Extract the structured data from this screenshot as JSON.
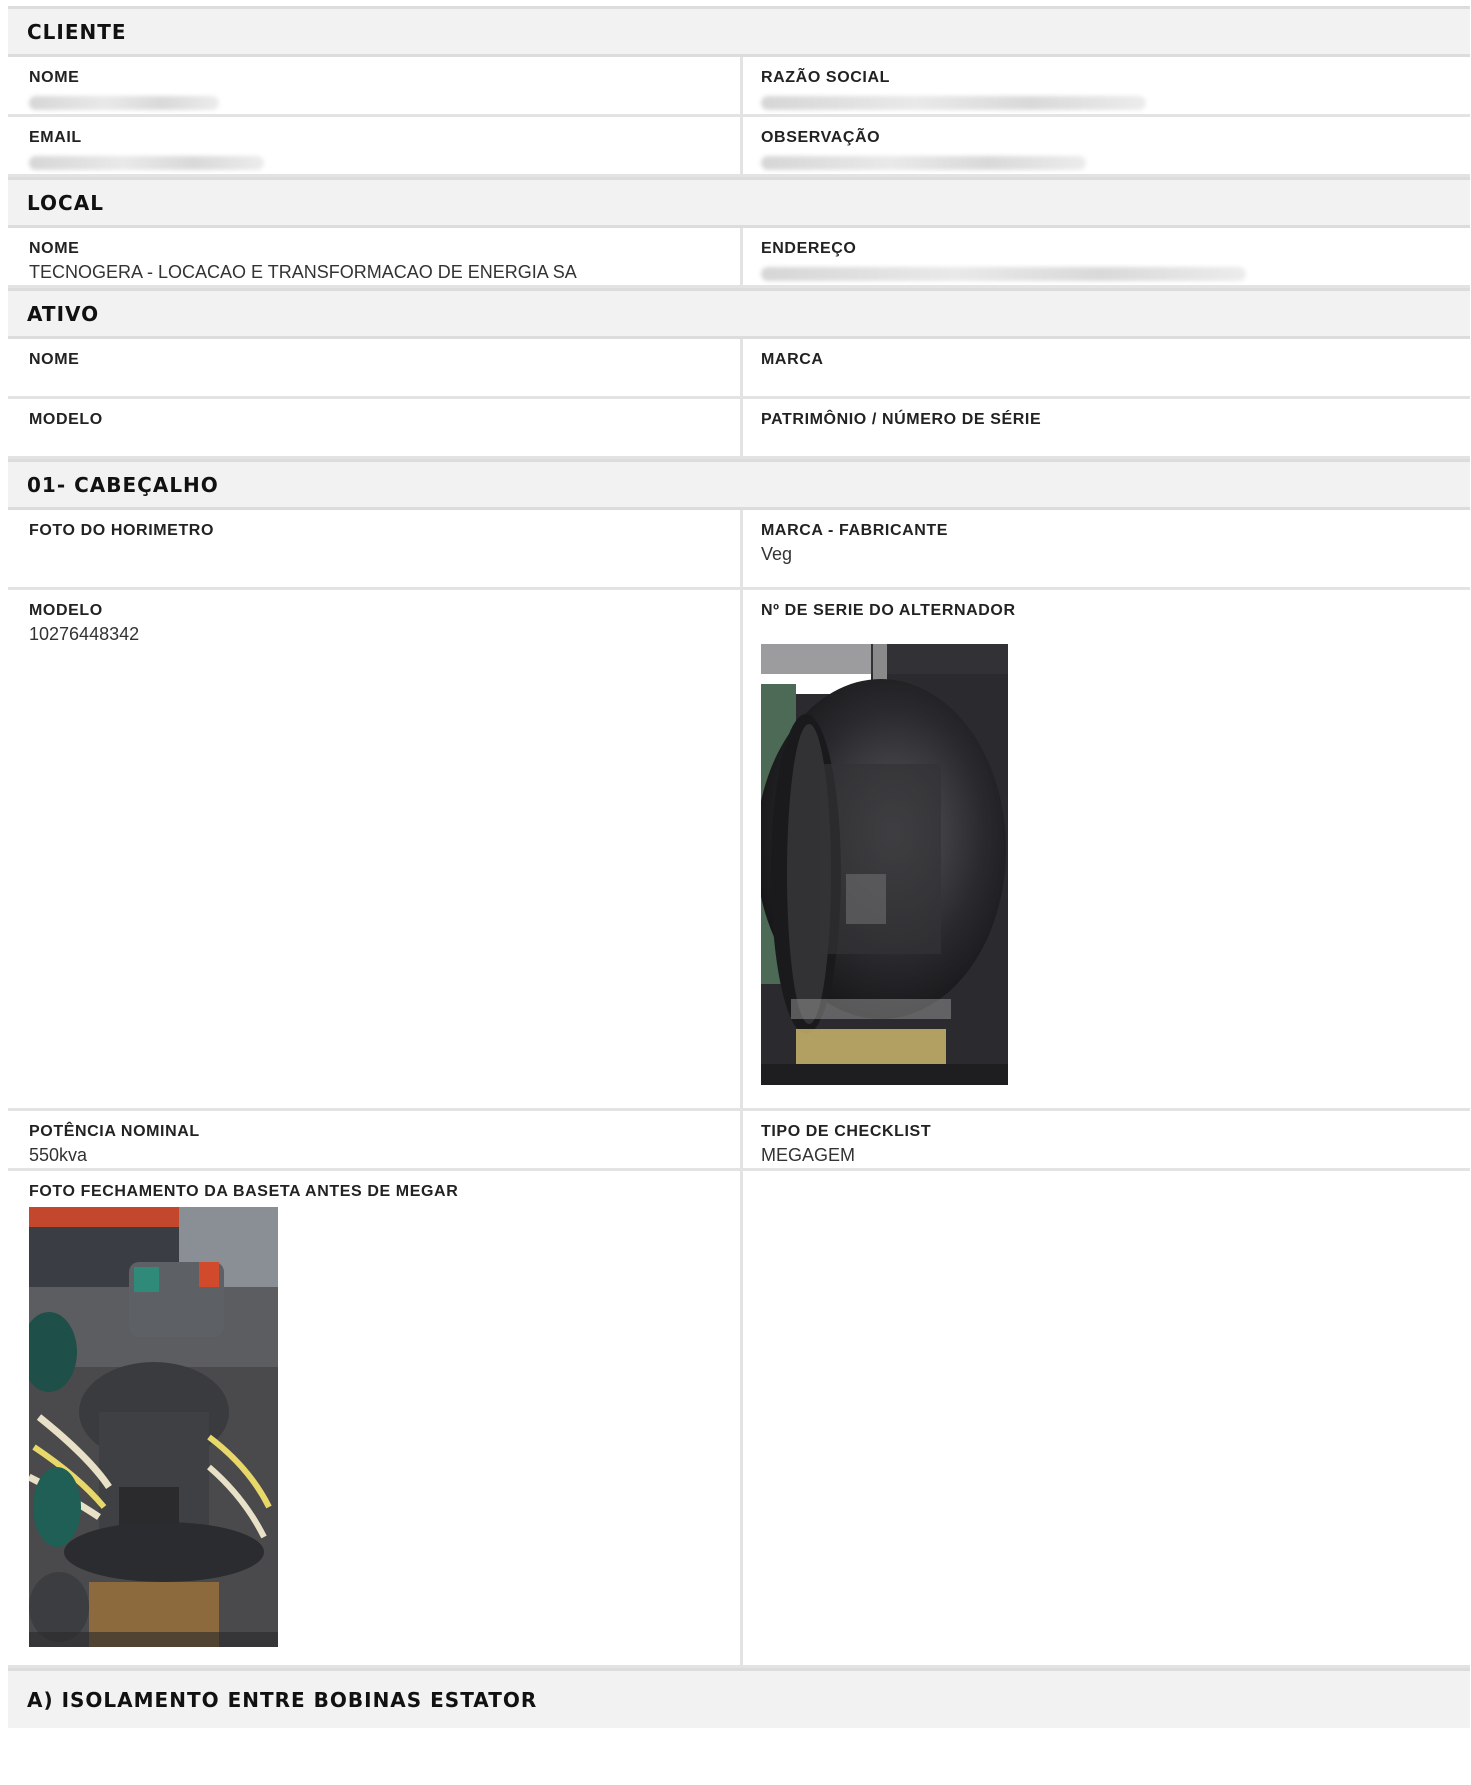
{
  "sections": {
    "cliente": {
      "title": "CLIENTE",
      "nome_label": "NOME",
      "razao_label": "RAZÃO SOCIAL",
      "email_label": "EMAIL",
      "obs_label": "OBSERVAÇÃO"
    },
    "local": {
      "title": "LOCAL",
      "nome_label": "NOME",
      "nome_value": "TECNOGERA - LOCACAO E TRANSFORMACAO DE ENERGIA SA",
      "endereco_label": "ENDEREÇO"
    },
    "ativo": {
      "title": "ATIVO",
      "nome_label": "NOME",
      "marca_label": "MARCA",
      "modelo_label": "MODELO",
      "patrimonio_label": "PATRIMÔNIO / NÚMERO DE SÉRIE"
    },
    "cabecalho": {
      "title": "01- CABEÇALHO",
      "foto_horimetro_label": "FOTO DO HORIMETRO",
      "marca_fabricante_label": "MARCA - FABRICANTE",
      "marca_fabricante_value": "Veg",
      "modelo_label": "MODELO",
      "modelo_value": "10276448342",
      "serie_label": "Nº DE SERIE DO ALTERNADOR",
      "potencia_label": "POTÊNCIA NOMINAL",
      "potencia_value": "550kva",
      "tipo_label": "TIPO DE CHECKLIST",
      "tipo_value": "MEGAGEM",
      "foto_baseta_label": "FOTO FECHAMENTO DA BASETA ANTES DE MEGAR"
    },
    "isolamento": {
      "title": "A) ISOLAMENTO ENTRE BOBINAS ESTATOR"
    }
  }
}
